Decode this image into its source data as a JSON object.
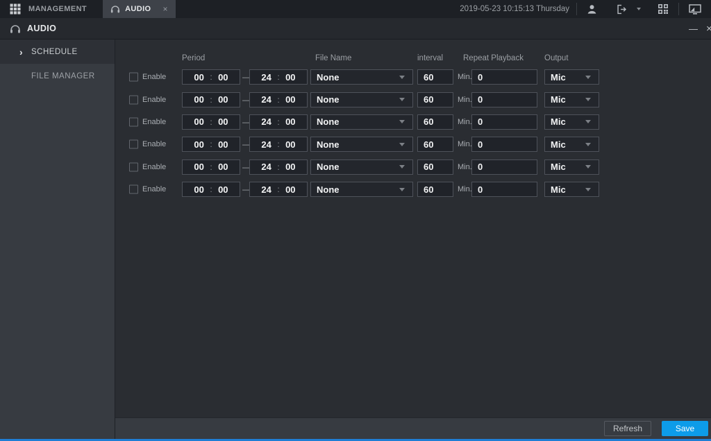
{
  "colors": {
    "accent_blue": "#0d9ce9",
    "bottom_line_blue": "#1f7ed5"
  },
  "icons": {
    "tab_close_glyph": "×",
    "window_minimize_glyph": "—",
    "window_close_glyph": "×",
    "sidebar_chevron_glyph": "›",
    "time_colon_glyph": ":",
    "period_separator_glyph": "—"
  },
  "topbar": {
    "management_tab": "MANAGEMENT",
    "audio_tab": "AUDIO",
    "datetime": "2019-05-23 10:15:13 Thursday"
  },
  "titlebar": {
    "title": "AUDIO"
  },
  "sidebar": {
    "items": [
      {
        "label": "SCHEDULE",
        "active": true
      },
      {
        "label": "FILE MANAGER",
        "active": false
      }
    ]
  },
  "schedule": {
    "headers": {
      "period": "Period",
      "file_name": "File Name",
      "interval": "interval",
      "repeat_playback": "Repeat Playback",
      "output": "Output"
    },
    "row_labels": {
      "enable": "Enable",
      "min": "Min."
    },
    "rows": [
      {
        "enabled": false,
        "start_h": "00",
        "start_m": "00",
        "end_h": "24",
        "end_m": "00",
        "file_name": "None",
        "interval": "60",
        "repeat_playback": "0",
        "output": "Mic"
      },
      {
        "enabled": false,
        "start_h": "00",
        "start_m": "00",
        "end_h": "24",
        "end_m": "00",
        "file_name": "None",
        "interval": "60",
        "repeat_playback": "0",
        "output": "Mic"
      },
      {
        "enabled": false,
        "start_h": "00",
        "start_m": "00",
        "end_h": "24",
        "end_m": "00",
        "file_name": "None",
        "interval": "60",
        "repeat_playback": "0",
        "output": "Mic"
      },
      {
        "enabled": false,
        "start_h": "00",
        "start_m": "00",
        "end_h": "24",
        "end_m": "00",
        "file_name": "None",
        "interval": "60",
        "repeat_playback": "0",
        "output": "Mic"
      },
      {
        "enabled": false,
        "start_h": "00",
        "start_m": "00",
        "end_h": "24",
        "end_m": "00",
        "file_name": "None",
        "interval": "60",
        "repeat_playback": "0",
        "output": "Mic"
      },
      {
        "enabled": false,
        "start_h": "00",
        "start_m": "00",
        "end_h": "24",
        "end_m": "00",
        "file_name": "None",
        "interval": "60",
        "repeat_playback": "0",
        "output": "Mic"
      }
    ]
  },
  "footer": {
    "refresh_label": "Refresh",
    "save_label": "Save"
  }
}
